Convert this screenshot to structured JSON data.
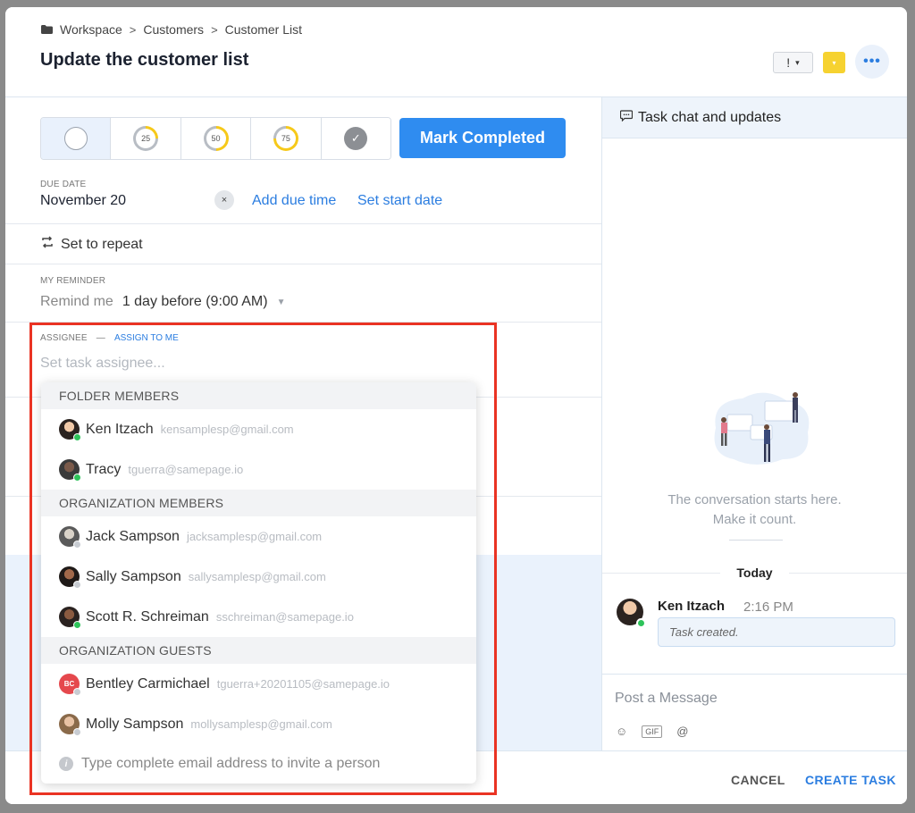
{
  "breadcrumb": [
    "Workspace",
    "Customers",
    "Customer List"
  ],
  "breadcrumb_sep": ">",
  "title": "Update the customer list",
  "header": {
    "priority_label": "!",
    "more_label": "•••"
  },
  "progress": {
    "steps": [
      "",
      "25",
      "50",
      "75",
      ""
    ],
    "selected_index": 0
  },
  "mark_completed": "Mark Completed",
  "due": {
    "label": "DUE DATE",
    "value": "November 20",
    "clear": "×",
    "add_time": "Add due time",
    "start_date": "Set start date"
  },
  "repeat": "Set to repeat",
  "reminder": {
    "label": "MY REMINDER",
    "prefix": "Remind me",
    "value": "1 day before (9:00 AM)"
  },
  "assignee": {
    "label": "ASSIGNEE",
    "dash": "—",
    "assign_me": "ASSIGN TO ME",
    "placeholder": "Set task assignee..."
  },
  "dropdown": {
    "groups": [
      {
        "title": "FOLDER MEMBERS",
        "people": [
          {
            "name": "Ken Itzach",
            "email": "kensamplesp@gmail.com",
            "status": "online"
          },
          {
            "name": "Tracy",
            "email": "tguerra@samepage.io",
            "status": "online"
          }
        ]
      },
      {
        "title": "ORGANIZATION MEMBERS",
        "people": [
          {
            "name": "Jack Sampson",
            "email": "jacksamplesp@gmail.com",
            "status": "offline"
          },
          {
            "name": "Sally Sampson",
            "email": "sallysamplesp@gmail.com",
            "status": "offline"
          },
          {
            "name": "Scott R. Schreiman",
            "email": "sschreiman@samepage.io",
            "status": "online"
          }
        ]
      },
      {
        "title": "ORGANIZATION GUESTS",
        "people": [
          {
            "name": "Bentley Carmichael",
            "email": "tguerra+20201105@samepage.io",
            "status": "offline",
            "initials": "BC"
          },
          {
            "name": "Molly Sampson",
            "email": "mollysamplesp@gmail.com",
            "status": "offline"
          }
        ]
      }
    ],
    "footer": "Type complete email address to invite a person"
  },
  "chat": {
    "header": "Task chat and updates",
    "empty_line1": "The conversation starts here.",
    "empty_line2": "Make it count.",
    "today": "Today",
    "message": {
      "author": "Ken Itzach",
      "time": "2:16 PM",
      "text": "Task created."
    },
    "post_placeholder": "Post a Message",
    "gif": "GIF",
    "at": "@"
  },
  "footer": {
    "cancel": "CANCEL",
    "create": "CREATE TASK"
  },
  "colors": {
    "accent": "#2f8cf0",
    "highlight": "#ea3323",
    "priority_yellow": "#f6d230",
    "online": "#2ec35a"
  }
}
